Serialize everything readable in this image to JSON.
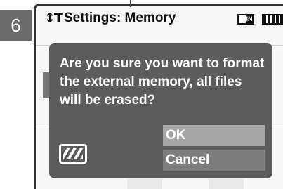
{
  "step_number": "6",
  "header": {
    "title": "Settings: Memory",
    "settings_icon": "settings-icon",
    "memory_indicator": {
      "icon": "memory-icon",
      "label": "IN"
    },
    "battery_icon": "battery-icon"
  },
  "dialog": {
    "message": "Are you sure you want to format the external memory, all files will be erased?",
    "card_icon": "sd-card-icon",
    "buttons": [
      {
        "label": "OK",
        "selected": true
      },
      {
        "label": "Cancel",
        "selected": false
      }
    ]
  },
  "colors": {
    "dialog_bg": "#5c5c5c",
    "selected_button": "#a6a6a6",
    "unselected_button": "#7d7d7d",
    "step_box": "#6a6a6a"
  }
}
